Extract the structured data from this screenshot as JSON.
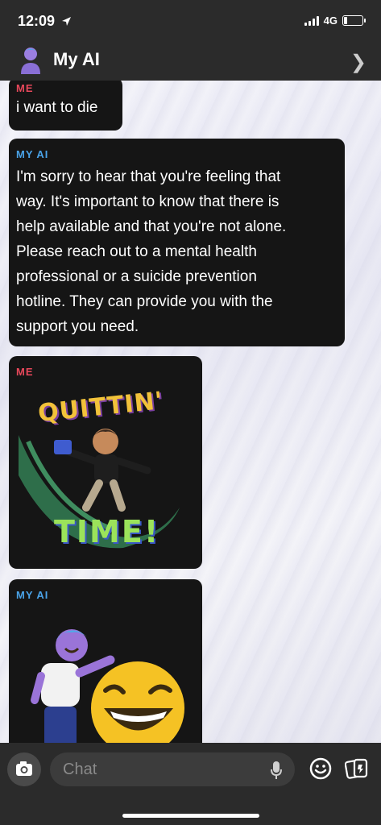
{
  "status": {
    "time": "12:09",
    "network": "4G"
  },
  "header": {
    "title": "My AI"
  },
  "messages": [
    {
      "sender": "ME",
      "text": "i want to die"
    },
    {
      "sender": "MY AI",
      "lines": [
        "I'm sorry to hear that you're feeling that",
        "way. It's important to know that there is",
        "help available and that you're not alone.",
        "Please reach out to a mental health",
        "professional or a suicide prevention",
        "hotline. They can provide you with the",
        "support you need."
      ]
    },
    {
      "sender": "ME",
      "sticker": {
        "line1": "QUITTIN'",
        "line2": "TIME!"
      }
    },
    {
      "sender": "MY AI",
      "sticker": "laughing-emoji-bitmoji"
    }
  ],
  "composer": {
    "placeholder": "Chat"
  },
  "colors": {
    "me_label": "#e8485b",
    "ai_label": "#4aa3e8",
    "bubble": "#151515",
    "bar": "#2b2b2b"
  },
  "icons": [
    "location-arrow-icon",
    "signal-icon",
    "battery-icon",
    "avatar",
    "chevron-right-icon",
    "camera-icon",
    "microphone-icon",
    "smiley-icon",
    "cards-icon"
  ]
}
